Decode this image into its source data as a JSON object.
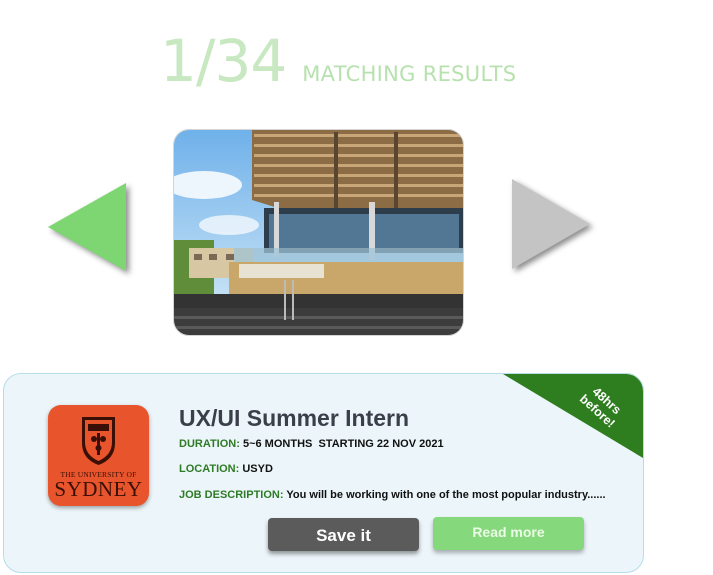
{
  "results": {
    "count": "1/34",
    "label": "MATCHING RESULTS"
  },
  "nav": {
    "prev_icon": "triangle-left-arrow",
    "next_icon": "triangle-right-arrow"
  },
  "photo": {
    "subject": "university building photo"
  },
  "job": {
    "ribbon_text": "48hrs before!",
    "title": "UX/UI Summer Intern",
    "duration_label": "DURATION:",
    "duration_value": "5~6 MONTHS  STARTING 22 NOV 2021",
    "location_label": "LOCATION:",
    "location_value": "USYD",
    "description_label": "JOB DESCRIPTION:",
    "description_value": "You will be working with one of the most popular industry......",
    "logo_line1": "THE UNIVERSITY OF",
    "logo_line2": "SYDNEY"
  },
  "actions": {
    "save_label": "Save it",
    "read_more_label": "Read more"
  },
  "colors": {
    "accent_green": "#7dd672",
    "ribbon_green": "#2e7d1f",
    "label_green": "#2f7a25",
    "logo_orange": "#e8542c",
    "card_bg": "#ecf6fa"
  }
}
